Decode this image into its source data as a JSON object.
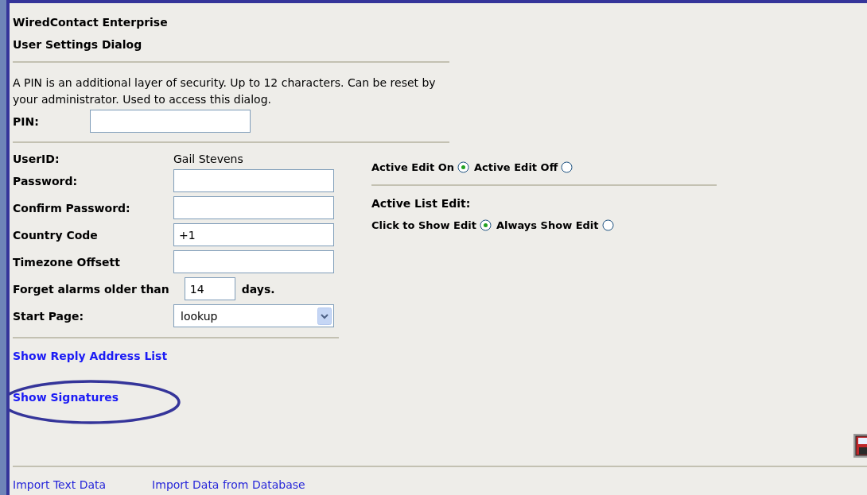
{
  "app_title": "WiredContact Enterprise",
  "dialog_title": "User Settings Dialog",
  "pin_section": {
    "description": "A PIN is an additional layer of security. Up to 12 characters. Can be reset by your administrator. Used to access this dialog.",
    "label": "PIN:"
  },
  "fields": [
    {
      "kind": "text",
      "label": "UserID:",
      "value": "Gail Stevens"
    },
    {
      "kind": "input",
      "label": "Password:"
    },
    {
      "kind": "input",
      "label": "Confirm Password:"
    },
    {
      "kind": "input",
      "label": "Country Code",
      "value": "+1"
    },
    {
      "kind": "input",
      "label": "Timezone Offsett"
    },
    {
      "kind": "inline_input",
      "label": "Forget alarms older than",
      "value": "14",
      "suffix": "days."
    },
    {
      "kind": "select",
      "label": "Start Page:",
      "value": "lookup"
    }
  ],
  "active_edit": {
    "options": [
      {
        "label": "Active Edit On",
        "selected": true
      },
      {
        "label": "Active Edit Off",
        "selected": false
      }
    ]
  },
  "active_list_edit": {
    "title": "Active List Edit:",
    "options": [
      {
        "label": "Click to Show Edit",
        "selected": true
      },
      {
        "label": "Always Show Edit",
        "selected": false
      }
    ]
  },
  "links": [
    {
      "label": "Show Reply Address List",
      "circled": false
    },
    {
      "label": "Show Signatures",
      "circled": true
    }
  ],
  "footer_links": [
    "Import Text Data",
    "Import Data from Database"
  ]
}
